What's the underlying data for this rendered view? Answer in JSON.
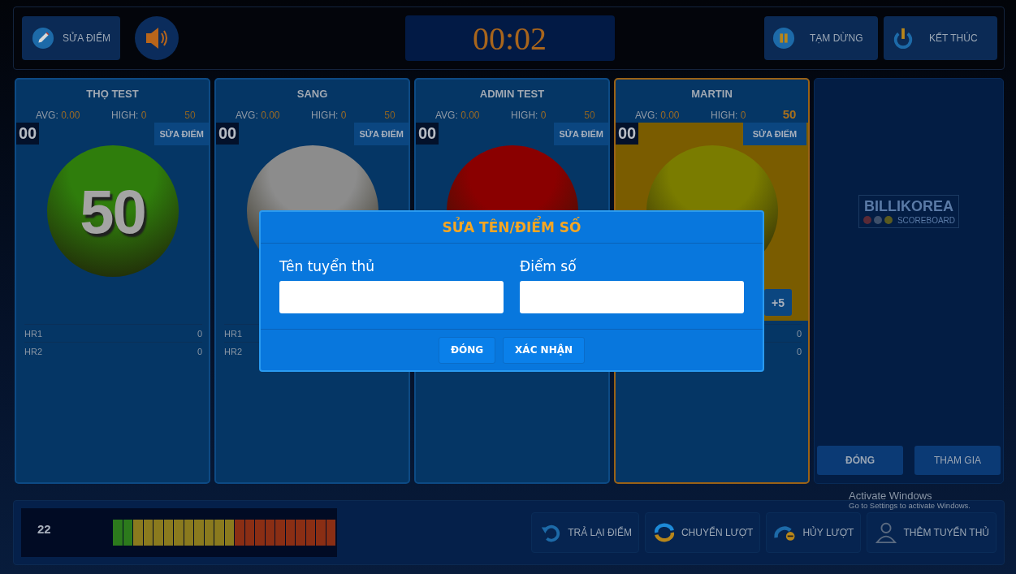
{
  "top_bar": {
    "edit_button": "SỬA ĐIỂM",
    "timer": "00:02",
    "pause_button": "TẠM DỪNG",
    "end_button": "KẾT THÚC"
  },
  "players": [
    {
      "name": "THỌ TEST",
      "avg_label": "AVG:",
      "avg": "0.00",
      "high_label": "HIGH:",
      "high": "0",
      "target": "50",
      "score": "00",
      "edit_button": "SỬA ĐIỂM",
      "ball": "50",
      "color": "#2f7d0c",
      "selected": false,
      "hr": [
        {
          "label": "HR1",
          "value": "0"
        },
        {
          "label": "HR2",
          "value": "0"
        }
      ]
    },
    {
      "name": "SANG",
      "avg_label": "AVG:",
      "avg": "0.00",
      "high_label": "HIGH:",
      "high": "0",
      "target": "50",
      "score": "00",
      "edit_button": "SỬA ĐIỂM",
      "color": "#8c8c8c",
      "selected": false,
      "hr": [
        {
          "label": "HR1"
        },
        {
          "label": "HR2"
        }
      ]
    },
    {
      "name": "ADMIN TEST",
      "avg_label": "AVG:",
      "avg": "0.00",
      "high_label": "HIGH:",
      "high": "0",
      "target": "50",
      "score": "00",
      "edit_button": "SỬA ĐIỂM",
      "color": "#8a0000",
      "selected": false
    },
    {
      "name": "MARTIN",
      "avg_label": "AVG:",
      "avg": "0.00",
      "high_label": "HIGH:",
      "high": "0",
      "target": "50",
      "score": "00",
      "edit_button": "SỬA ĐIỂM",
      "color": "#7a7c00",
      "selected": true,
      "plus_button": "+5",
      "hr": [
        {
          "value": "0"
        },
        {
          "value": "0"
        }
      ]
    }
  ],
  "side_panel": {
    "logo_title": "BILLIKOREA",
    "logo_subtitle": "SCOREBOARD",
    "close_button": "ĐÓNG",
    "join_button": "THAM GIA"
  },
  "bottom_bar": {
    "shot_clock": "22",
    "segments": [
      {
        "color": "#2c7a1c"
      },
      {
        "color": "#2c7a1c"
      },
      {
        "color": "#8a7a1e"
      },
      {
        "color": "#8a7a1e"
      },
      {
        "color": "#8a7a1e"
      },
      {
        "color": "#8a7a1e"
      },
      {
        "color": "#8a7a1e"
      },
      {
        "color": "#8a7a1e"
      },
      {
        "color": "#8a7a1e"
      },
      {
        "color": "#8a7a1e"
      },
      {
        "color": "#8a7a1e"
      },
      {
        "color": "#8a7a1e"
      },
      {
        "color": "#8a2e14"
      },
      {
        "color": "#8a2e14"
      },
      {
        "color": "#8a2e14"
      },
      {
        "color": "#8a2e14"
      },
      {
        "color": "#8a2e14"
      },
      {
        "color": "#8a2e14"
      },
      {
        "color": "#8a2e14"
      },
      {
        "color": "#8a2e14"
      },
      {
        "color": "#8a2e14"
      },
      {
        "color": "#8a2e14"
      }
    ],
    "actions": [
      {
        "kind": "undo",
        "label": "TRẢ LẠI ĐIỂM"
      },
      {
        "kind": "switch",
        "label": "CHUYỂN LƯỢT"
      },
      {
        "kind": "cancel",
        "label": "HỦY LƯỢT"
      },
      {
        "kind": "add",
        "label": "THÊM TUYỂN THỦ"
      }
    ]
  },
  "modal": {
    "title": "SỬA TÊN/ĐIỂM SỐ",
    "name_label": "Tên tuyển thủ",
    "score_label": "Điểm số",
    "close_button": "ĐÓNG",
    "confirm_button": "XÁC NHẬN"
  },
  "os_notice": {
    "title": "Activate Windows",
    "text": "Go to Settings to activate Windows."
  }
}
